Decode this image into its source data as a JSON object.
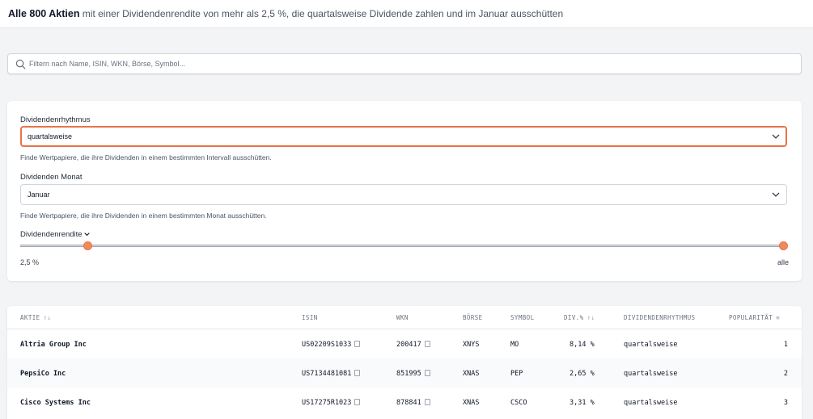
{
  "header": {
    "count_label": "Alle 800 Aktien",
    "description": " mit einer Dividendenrendite von mehr als 2,5 %, die quartalsweise Dividende zahlen und im Januar ausschütten"
  },
  "search": {
    "placeholder": "Filtern nach Name, ISIN, WKN, Börse, Symbol..."
  },
  "filters": {
    "rhythm": {
      "label": "Dividendenrhythmus",
      "value": "quartalsweise",
      "hint": "Finde Wertpapiere, die ihre Dividenden in einem bestimmten Intervall ausschütten."
    },
    "month": {
      "label": "Dividenden Monat",
      "value": "Januar",
      "hint": "Finde Wertpapiere, die ihre Dividenden in einem bestimmten Monat ausschütten."
    },
    "yield": {
      "label": "Dividendenrendite",
      "min_label": "2,5 %",
      "max_label": "alle"
    }
  },
  "table": {
    "columns": {
      "aktie": "AKTIE",
      "isin": "ISIN",
      "wkn": "WKN",
      "boerse": "BÖRSE",
      "symbol": "SYMBOL",
      "div": "DIV.%",
      "rhythm": "DIVIDENDENRHYTHMUS",
      "pop": "POPULARITÄT"
    },
    "rows": [
      {
        "name": "Altria Group Inc",
        "isin": "US02209S1033",
        "wkn": "200417",
        "exchange": "XNYS",
        "symbol": "MO",
        "div": "8,14 %",
        "rhythm": "quartalsweise",
        "pop": "1"
      },
      {
        "name": "PepsiCo Inc",
        "isin": "US7134481081",
        "wkn": "851995",
        "exchange": "XNAS",
        "symbol": "PEP",
        "div": "2,65 %",
        "rhythm": "quartalsweise",
        "pop": "2"
      },
      {
        "name": "Cisco Systems Inc",
        "isin": "US17275R1023",
        "wkn": "878841",
        "exchange": "XNAS",
        "symbol": "CSCO",
        "div": "3,31 %",
        "rhythm": "quartalsweise",
        "pop": "3"
      }
    ]
  },
  "colors": {
    "accent": "#e8734a",
    "thumb": "#f08a5d"
  }
}
